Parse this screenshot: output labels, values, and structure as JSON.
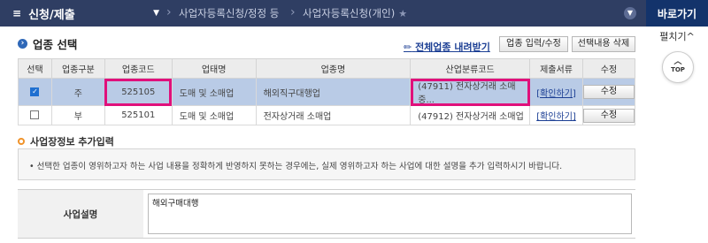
{
  "nav": {
    "home_label": "신청/제출",
    "crumb1": "사업자등록신청/정정 등",
    "crumb2": "사업자등록신청(개인)",
    "quick_label": "바로가기",
    "expand_label": "펼치기^",
    "top_label": "TOP"
  },
  "section": {
    "title": "업종 선택",
    "download_link": "전체업종 내려받기",
    "input_button": "업종 입력/수정",
    "delete_button": "선택내용 삭제"
  },
  "table": {
    "headers": [
      "선택",
      "업종구분",
      "업종코드",
      "업태명",
      "업종명",
      "산업분류코드",
      "제출서류",
      "수정"
    ],
    "rows": [
      {
        "checked": true,
        "type": "주",
        "code": "525105",
        "business_type": "도매 및 소매업",
        "industry_name": "해외직구대행업",
        "class_code": "(47911) 전자상거래 소매 중...",
        "document": "[확인하기]",
        "edit": "수정"
      },
      {
        "checked": false,
        "type": "부",
        "code": "525101",
        "business_type": "도매 및 소매업",
        "industry_name": "전자상거래 소매업",
        "class_code": "(47912) 전자상거래 소매업",
        "document": "[확인하기]",
        "edit": "수정"
      }
    ]
  },
  "extra": {
    "title": "사업장정보 추가입력",
    "notice": "• 선택한 업종이 영위하고자 하는 사업 내용을 정확하게 반영하지 못하는 경우에는, 실제 영위하고자 하는 사업에 대한 설명을 추가 입력하시기 바랍니다.",
    "field_label": "사업설명",
    "field_value": "해외구매대행"
  }
}
